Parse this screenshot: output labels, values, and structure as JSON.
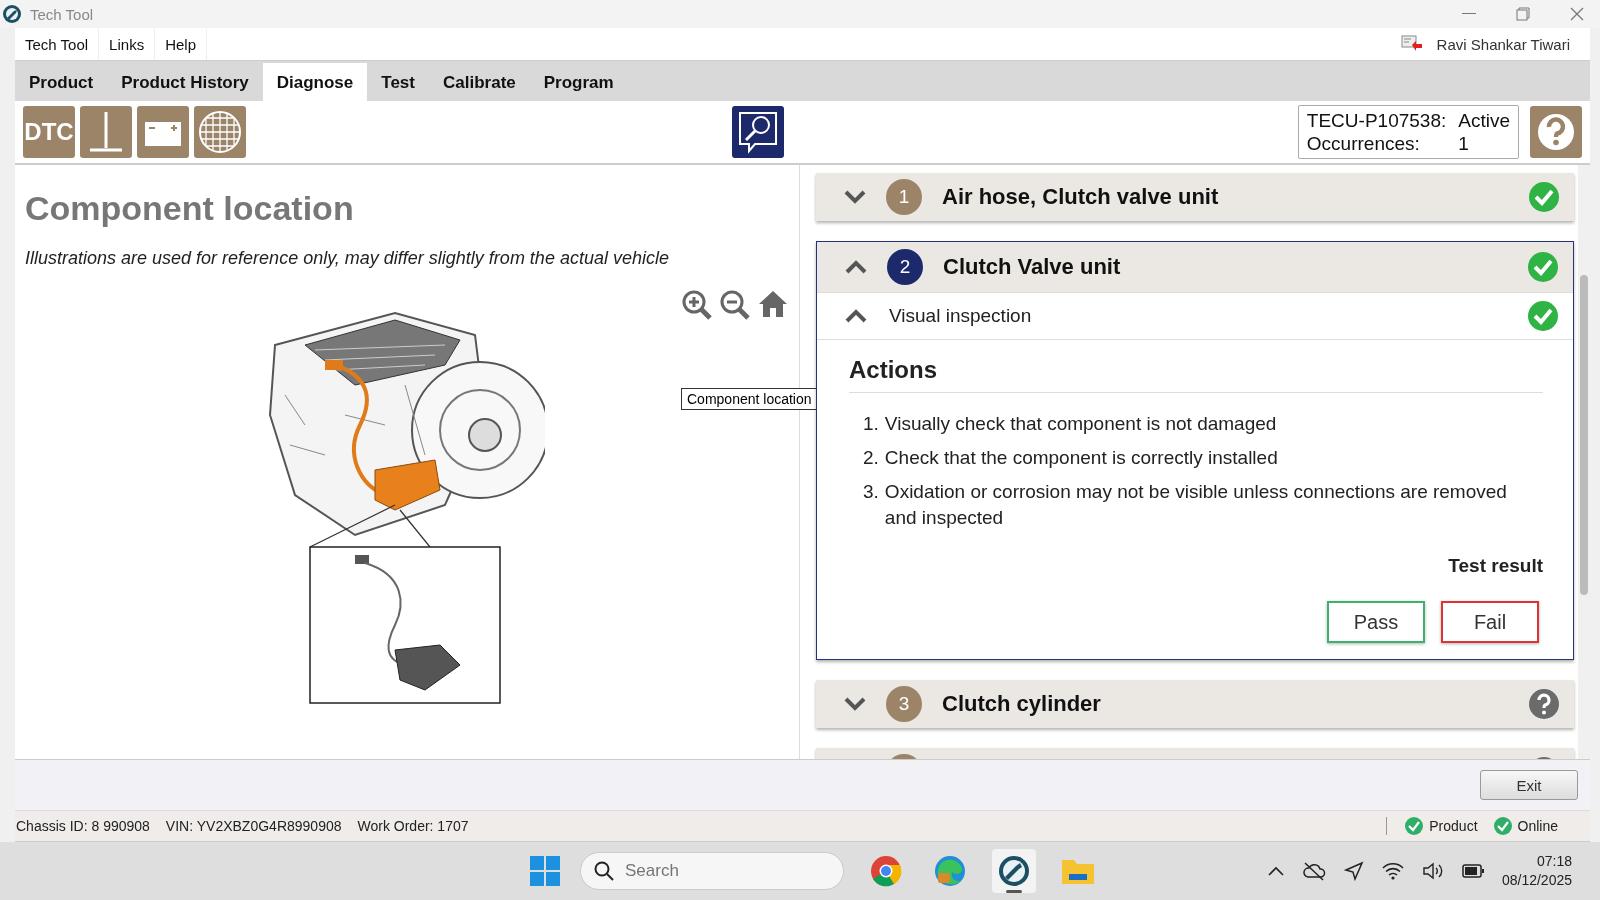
{
  "window": {
    "title": "Tech Tool"
  },
  "menu": [
    {
      "label": "Tech Tool"
    },
    {
      "label": "Links"
    },
    {
      "label": "Help"
    }
  ],
  "user": {
    "name": "Ravi Shankar Tiwari"
  },
  "tabs": [
    {
      "label": "Product",
      "selected": false
    },
    {
      "label": "Product History",
      "selected": false
    },
    {
      "label": "Diagnose",
      "selected": true
    },
    {
      "label": "Test",
      "selected": false
    },
    {
      "label": "Calibrate",
      "selected": false
    },
    {
      "label": "Program",
      "selected": false
    }
  ],
  "toolbar": [
    {
      "kind": "dtc",
      "label": "DTC"
    },
    {
      "kind": "ground"
    },
    {
      "kind": "battery"
    },
    {
      "kind": "globe"
    }
  ],
  "fault": {
    "code": "TECU-P107538:",
    "status": "Active",
    "occurrences_label": "Occurrences:",
    "occurrences": "1"
  },
  "left": {
    "title": "Component location",
    "note": "Illustrations are used for reference only, may differ slightly from the actual vehicle",
    "tooltip": "Component location"
  },
  "steps": [
    {
      "number": "1",
      "title": "Air hose, Clutch valve unit",
      "expanded": false,
      "passed": true
    },
    {
      "number": "2",
      "title": "Clutch Valve unit",
      "expanded": true,
      "passed": true,
      "substep": {
        "title": "Visual inspection",
        "expanded": true,
        "passed": true
      },
      "actions_title": "Actions",
      "actions": [
        {
          "marker": "1.",
          "text": "Visually check that component is not damaged"
        },
        {
          "marker": "2.",
          "text": "Check that the component is correctly installed"
        },
        {
          "marker": "3.",
          "text": "Oxidation or corrosion may not be visible unless connections are removed and inspected"
        }
      ],
      "result_label": "Test result",
      "buttons": [
        {
          "kind": "pass",
          "label": "Pass"
        },
        {
          "kind": "fail",
          "label": "Fail"
        }
      ]
    },
    {
      "number": "3",
      "title": "Clutch cylinder",
      "expanded": false,
      "passed": false
    },
    {
      "expanded": false,
      "passed": false
    }
  ],
  "footer": {
    "exit": "Exit"
  },
  "status_bar": {
    "chassis": "Chassis ID: 8 990908",
    "vin": "VIN: YV2XBZ0G4R8990908",
    "work_order": "Work Order: 1707",
    "indicators": [
      {
        "label": "Product",
        "ok": true
      },
      {
        "label": "Online",
        "ok": true
      }
    ]
  },
  "taskbar": {
    "search_placeholder": "Search",
    "apps": [
      {
        "kind": "chrome",
        "selected": false
      },
      {
        "kind": "edge",
        "selected": false
      },
      {
        "kind": "techtool",
        "selected": true
      },
      {
        "kind": "folder",
        "selected": false
      }
    ],
    "time": "07:18",
    "date": "08/12/2025"
  }
}
